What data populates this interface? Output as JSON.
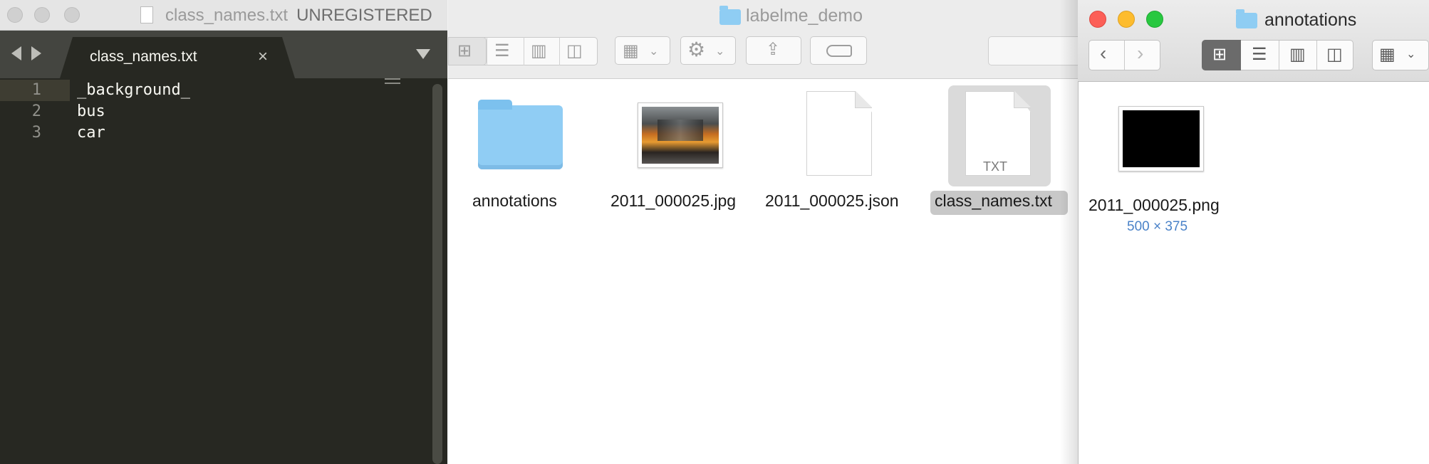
{
  "editor": {
    "window_title": "class_names.txt",
    "license_status": "UNREGISTERED",
    "tab_label": "class_names.txt",
    "close_glyph": "×",
    "lines": [
      {
        "num": "1",
        "text": "_background_"
      },
      {
        "num": "2",
        "text": "bus"
      },
      {
        "num": "3",
        "text": "car"
      }
    ],
    "colors": {
      "background": "#272822",
      "text": "#f8f8f2",
      "gutter": "#90908a"
    }
  },
  "finder_main": {
    "title": "labelme_demo",
    "toolbar": {
      "view_icons": [
        "icon-view-icon",
        "list-view-icon",
        "column-view-icon",
        "cover-flow-view-icon"
      ],
      "group_icon": "arrange-icon",
      "action_icon": "gear-icon",
      "share_icon": "share-icon",
      "tag_icon": "tag-icon"
    },
    "items": [
      {
        "name": "annotations",
        "kind": "folder"
      },
      {
        "name": "2011_000025.jpg",
        "kind": "image"
      },
      {
        "name": "2011_000025.json",
        "kind": "document"
      },
      {
        "name": "class_names.txt",
        "kind": "text",
        "badge": "TXT",
        "selected": true
      }
    ]
  },
  "finder_annotations": {
    "title": "annotations",
    "traffic_lights": {
      "close": "#fc5f57",
      "minimize": "#fdbc2e",
      "zoom": "#28c840"
    },
    "items": [
      {
        "name": "2011_000025.png",
        "meta": "500 × 375"
      }
    ],
    "accent_meta_color": "#4a82c8"
  }
}
